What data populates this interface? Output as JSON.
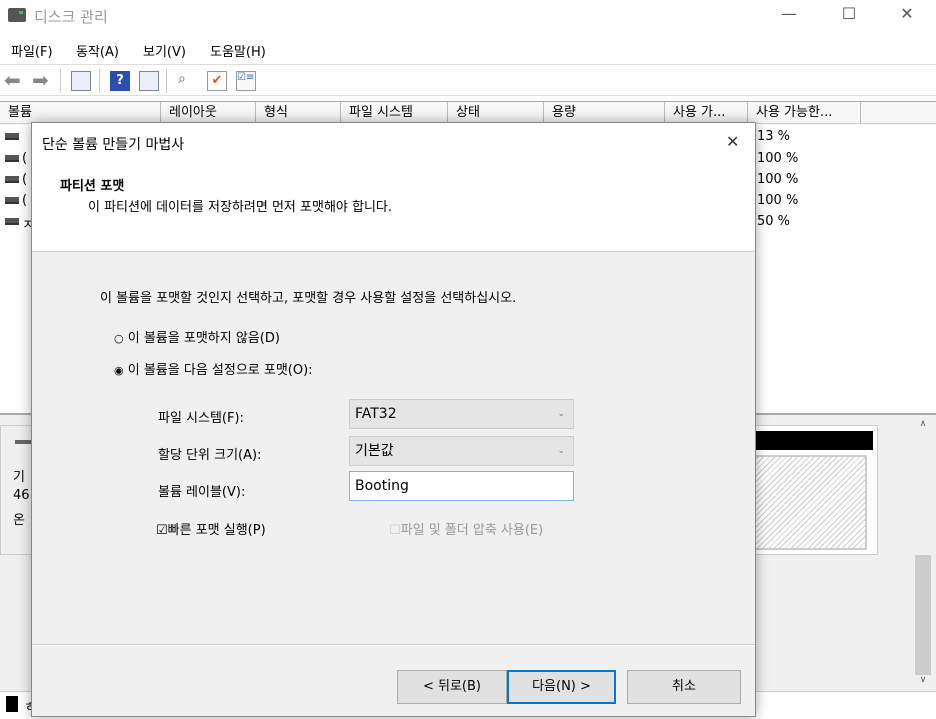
{
  "window": {
    "title": "디스크 관리",
    "minimize": "—",
    "maximize": "☐",
    "close": "✕"
  },
  "menu": [
    "파일(F)",
    "동작(A)",
    "보기(V)",
    "도움말(H)"
  ],
  "list": {
    "columns": [
      "볼륨",
      "레이아웃",
      "형식",
      "파일 시스템",
      "상태",
      "용량",
      "사용 가...",
      "사용 가능한..."
    ],
    "rows": [
      {
        "prefix": "",
        "pct": "13 %"
      },
      {
        "prefix": "(",
        "pct": "100 %"
      },
      {
        "prefix": "(",
        "pct": "100 %"
      },
      {
        "prefix": "(",
        "pct": "100 %"
      },
      {
        "prefix": "ㅈ",
        "pct": "50 %"
      }
    ]
  },
  "lower": {
    "lines": [
      "기",
      "46",
      "온"
    ],
    "legend_prefix": "ㅎ"
  },
  "dialog": {
    "title": "단순 볼륨 만들기 마법사",
    "close": "✕",
    "header_title": "파티션 포맷",
    "header_subtitle": "이 파티션에 데이터를 저장하려면 먼저 포맷해야 합니다.",
    "instruction": "이 볼륨을 포맷할 것인지 선택하고, 포맷할 경우 사용할 설정을 선택하십시오.",
    "radio_no_format": "이 볼륨을 포맷하지 않음(D)",
    "radio_format": "이 볼륨을 다음 설정으로 포맷(O):",
    "selected_radio": "format",
    "fs_label": "파일 시스템(F):",
    "fs_value": "FAT32",
    "alloc_label": "할당 단위 크기(A):",
    "alloc_value": "기본값",
    "vol_label": "볼륨 레이블(V):",
    "vol_value": "Booting",
    "quick_format": "빠른 포맷 실행(P)",
    "quick_format_checked": true,
    "compress": "파일 및 폴더 압축 사용(E)",
    "compress_checked": false,
    "back": "< 뒤로(B)",
    "next": "다음(N) >",
    "cancel": "취소"
  }
}
